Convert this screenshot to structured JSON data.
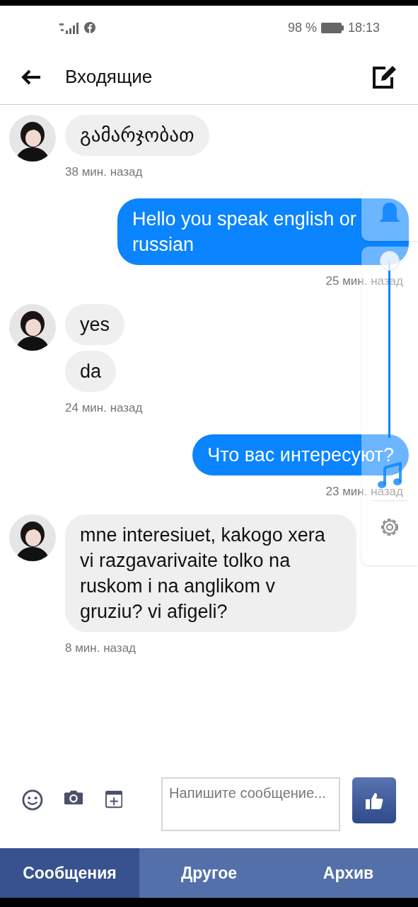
{
  "status_bar": {
    "battery": "98 %",
    "time": "18:13"
  },
  "header": {
    "title": "Входящие"
  },
  "messages": [
    {
      "kind": "incoming",
      "bubbles": [
        "გამარჯობათ"
      ],
      "time": "38 мин. назад"
    },
    {
      "kind": "outgoing",
      "bubbles": [
        "Hello you speak english or russian"
      ],
      "time": "25 мин. назад"
    },
    {
      "kind": "incoming",
      "bubbles": [
        "yes",
        "da"
      ],
      "time": "24 мин. назад"
    },
    {
      "kind": "outgoing",
      "bubbles": [
        "Что вас интересуют?"
      ],
      "time": "23 мин. назад"
    },
    {
      "kind": "incoming",
      "bubbles": [
        "mne interesiuet, kakogo xera vi razgavarivaite tolko na ruskom i na anglikom v gruziu? vi afigeli?"
      ],
      "time": "8 мин. назад"
    }
  ],
  "composer": {
    "placeholder": "Напишите сообщение..."
  },
  "tabs": [
    {
      "label": "Сообщения",
      "selected": true
    },
    {
      "label": "Другое",
      "selected": false
    },
    {
      "label": "Архив",
      "selected": false
    }
  ],
  "volume_panel": {
    "level": 1
  }
}
